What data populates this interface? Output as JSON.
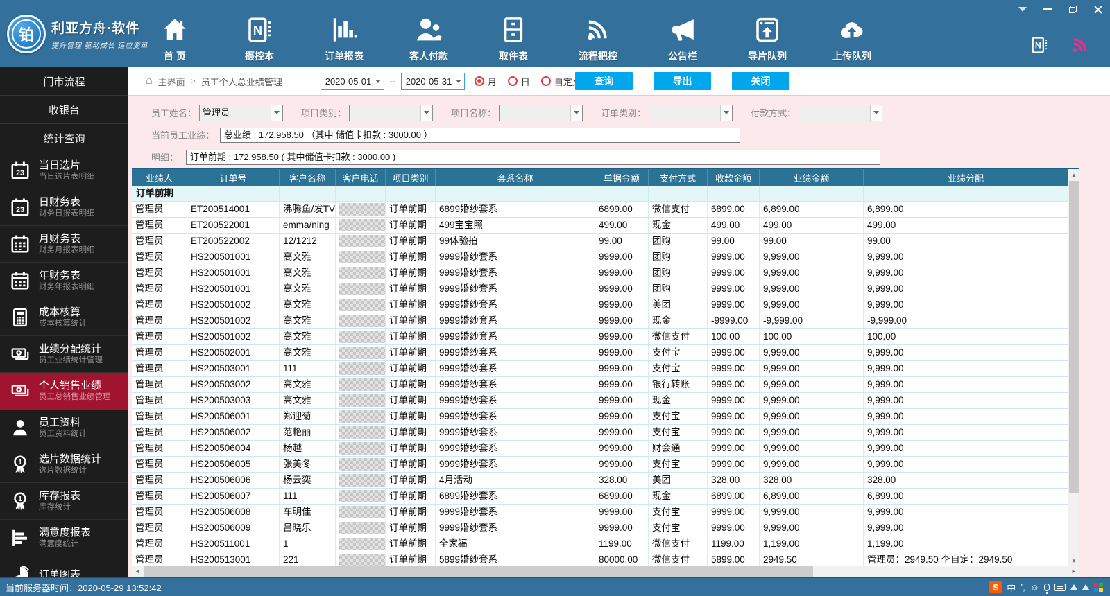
{
  "colors": {
    "topbar": "#33719C",
    "accent_button": "#01A7EC",
    "table_header": "#2A7396",
    "sidebar_active": "#A01430",
    "filter_panel": "#FBE9EC",
    "radio_red": "#E03C3C"
  },
  "titlebar": {
    "controls": [
      {
        "name": "menu-collapse"
      },
      {
        "name": "minimize"
      },
      {
        "name": "restore"
      },
      {
        "name": "close"
      }
    ]
  },
  "brand": {
    "logo_char": "铂",
    "name": "利亚方舟·软件",
    "tagline": "提升管理  驱动成长  适应变革"
  },
  "toolbar": {
    "items": [
      {
        "label": "首 页",
        "icon": "home-icon"
      },
      {
        "label": "摄控本",
        "icon": "notebook-icon"
      },
      {
        "label": "订单报表",
        "icon": "report-chart-icon"
      },
      {
        "label": "客人付款",
        "icon": "customers-icon"
      },
      {
        "label": "取件表",
        "icon": "pickup-cabinet-icon"
      },
      {
        "label": "流程把控",
        "icon": "workflow-signal-icon"
      },
      {
        "label": "公告栏",
        "icon": "megaphone-icon"
      },
      {
        "label": "导片队列",
        "icon": "export-queue-icon"
      },
      {
        "label": "上传队列",
        "icon": "cloud-upload-icon"
      }
    ],
    "tray": [
      {
        "icon": "onenote-icon"
      },
      {
        "icon": "wireless-pink-icon",
        "color": "#ED2E8D"
      }
    ]
  },
  "sidebar": {
    "entries": [
      {
        "type": "header",
        "label": "门市流程"
      },
      {
        "type": "header",
        "label": "收银台"
      },
      {
        "type": "header",
        "label": "统计查询"
      },
      {
        "type": "item",
        "icon": "calendar-day-icon",
        "title": "当日选片",
        "subtitle": "当日选片表明细"
      },
      {
        "type": "item",
        "icon": "calendar-day-icon",
        "title": "日财务表",
        "subtitle": "财务日报表明细"
      },
      {
        "type": "item",
        "icon": "calendar-month-icon",
        "title": "月财务表",
        "subtitle": "财务月报表明细"
      },
      {
        "type": "item",
        "icon": "calendar-year-icon",
        "title": "年财务表",
        "subtitle": "财务年报表明细"
      },
      {
        "type": "item",
        "icon": "calculator-icon",
        "title": "成本核算",
        "subtitle": "成本核算统计"
      },
      {
        "type": "item",
        "icon": "money-icon",
        "title": "业绩分配统计",
        "subtitle": "员工业绩统计管理"
      },
      {
        "type": "item",
        "icon": "money-icon",
        "title": "个人销售业绩",
        "subtitle": "员工总销售业绩管理",
        "active": true
      },
      {
        "type": "item",
        "icon": "person-icon",
        "title": "员工资料",
        "subtitle": "员工资料统计"
      },
      {
        "type": "item",
        "icon": "medal-icon",
        "title": "选片数据统计",
        "subtitle": "选片数据统计"
      },
      {
        "type": "item",
        "icon": "medal-icon",
        "title": "库存报表",
        "subtitle": "库存统计"
      },
      {
        "type": "item",
        "icon": "hbar-chart-icon",
        "title": "满意度报表",
        "subtitle": "满意度统计"
      },
      {
        "type": "item",
        "icon": "pie-chart-icon",
        "title": "订单图表",
        "subtitle": ""
      }
    ]
  },
  "breadcrumb": {
    "home_icon": "home-small-icon",
    "root": "主界面",
    "separator": ">",
    "current": "员工个人总业绩管理"
  },
  "date_filter": {
    "from": "2020-05-01",
    "separator": "--",
    "to": "2020-05-31",
    "options": [
      {
        "label": "月",
        "selected": true
      },
      {
        "label": "日",
        "selected": false
      },
      {
        "label": "自定义",
        "selected": false
      }
    ]
  },
  "action_buttons": [
    "查询",
    "导出",
    "关闭"
  ],
  "filters": [
    {
      "label": "员工姓名：",
      "value": "管理员"
    },
    {
      "label": "项目类别：",
      "value": ""
    },
    {
      "label": "项目名称：",
      "value": ""
    },
    {
      "label": "订单类别：",
      "value": ""
    },
    {
      "label": "付款方式：",
      "value": ""
    }
  ],
  "summary": {
    "performance_label": "当前员工业绩：",
    "performance_value": "总业绩 : 172,958.50   （其中  储值卡扣款 : 3000.00 ）",
    "detail_label": "明细：",
    "detail_value": "订单前期 : 172,958.50 ( 其中储值卡扣款 : 3000.00 )"
  },
  "table": {
    "columns": [
      "业绩人",
      "订单号",
      "客户名称",
      "客户电话",
      "项目类别",
      "套系名称",
      "单据金额",
      "支付方式",
      "收款金额",
      "业绩金额",
      "业绩分配"
    ],
    "group_header": "订单前期",
    "phone_censored": true,
    "rows": [
      [
        "管理员",
        "ET200514001",
        "沸腾鱼/发TV",
        "订单前期",
        "6899婚纱套系",
        "6899.00",
        "微信支付",
        "6899.00",
        "6,899.00",
        "6,899.00"
      ],
      [
        "管理员",
        "ET200522001",
        "emma/ning",
        "订单前期",
        "499宝宝照",
        "499.00",
        "现金",
        "499.00",
        "499.00",
        "499.00"
      ],
      [
        "管理员",
        "ET200522002",
        "12/1212",
        "订单前期",
        "99体验拍",
        "99.00",
        "团购",
        "99.00",
        "99.00",
        "99.00"
      ],
      [
        "管理员",
        "HS200501001",
        "高文雅",
        "订单前期",
        "9999婚纱套系",
        "9999.00",
        "团购",
        "9999.00",
        "9,999.00",
        "9,999.00"
      ],
      [
        "管理员",
        "HS200501001",
        "高文雅",
        "订单前期",
        "9999婚纱套系",
        "9999.00",
        "团购",
        "9999.00",
        "9,999.00",
        "9,999.00"
      ],
      [
        "管理员",
        "HS200501001",
        "高文雅",
        "订单前期",
        "9999婚纱套系",
        "9999.00",
        "团购",
        "9999.00",
        "9,999.00",
        "9,999.00"
      ],
      [
        "管理员",
        "HS200501002",
        "高文雅",
        "订单前期",
        "9999婚纱套系",
        "9999.00",
        "美团",
        "9999.00",
        "9,999.00",
        "9,999.00"
      ],
      [
        "管理员",
        "HS200501002",
        "高文雅",
        "订单前期",
        "9999婚纱套系",
        "9999.00",
        "现金",
        "-9999.00",
        "-9,999.00",
        "-9,999.00"
      ],
      [
        "管理员",
        "HS200501002",
        "高文雅",
        "订单前期",
        "9999婚纱套系",
        "9999.00",
        "微信支付",
        "100.00",
        "100.00",
        "100.00"
      ],
      [
        "管理员",
        "HS200502001",
        "高文雅",
        "订单前期",
        "9999婚纱套系",
        "9999.00",
        "支付宝",
        "9999.00",
        "9,999.00",
        "9,999.00"
      ],
      [
        "管理员",
        "HS200503001",
        "111",
        "订单前期",
        "9999婚纱套系",
        "9999.00",
        "支付宝",
        "9999.00",
        "9,999.00",
        "9,999.00"
      ],
      [
        "管理员",
        "HS200503002",
        "高文雅",
        "订单前期",
        "9999婚纱套系",
        "9999.00",
        "银行转账",
        "9999.00",
        "9,999.00",
        "9,999.00"
      ],
      [
        "管理员",
        "HS200503003",
        "高文雅",
        "订单前期",
        "9999婚纱套系",
        "9999.00",
        "现金",
        "9999.00",
        "9,999.00",
        "9,999.00"
      ],
      [
        "管理员",
        "HS200506001",
        "郑迎菊",
        "订单前期",
        "9999婚纱套系",
        "9999.00",
        "支付宝",
        "9999.00",
        "9,999.00",
        "9,999.00"
      ],
      [
        "管理员",
        "HS200506002",
        "范艳丽",
        "订单前期",
        "9999婚纱套系",
        "9999.00",
        "支付宝",
        "9999.00",
        "9,999.00",
        "9,999.00"
      ],
      [
        "管理员",
        "HS200506004",
        "杨越",
        "订单前期",
        "9999婚纱套系",
        "9999.00",
        "财会通",
        "9999.00",
        "9,999.00",
        "9,999.00"
      ],
      [
        "管理员",
        "HS200506005",
        "张美冬",
        "订单前期",
        "9999婚纱套系",
        "9999.00",
        "支付宝",
        "9999.00",
        "9,999.00",
        "9,999.00"
      ],
      [
        "管理员",
        "HS200506006",
        "杨云奕",
        "订单前期",
        "4月活动",
        "328.00",
        "美团",
        "328.00",
        "328.00",
        "328.00"
      ],
      [
        "管理员",
        "HS200506007",
        "111",
        "订单前期",
        "6899婚纱套系",
        "6899.00",
        "现金",
        "6899.00",
        "6,899.00",
        "6,899.00"
      ],
      [
        "管理员",
        "HS200506008",
        "车明佳",
        "订单前期",
        "9999婚纱套系",
        "9999.00",
        "支付宝",
        "9999.00",
        "9,999.00",
        "9,999.00"
      ],
      [
        "管理员",
        "HS200506009",
        "吕晓乐",
        "订单前期",
        "9999婚纱套系",
        "9999.00",
        "支付宝",
        "9999.00",
        "9,999.00",
        "9,999.00"
      ],
      [
        "管理员",
        "HS200511001",
        "1",
        "订单前期",
        "全家福",
        "1199.00",
        "微信支付",
        "1199.00",
        "1,199.00",
        "1,199.00"
      ],
      [
        "管理员",
        "HS200513001",
        "221",
        "订单前期",
        "5899婚纱套系",
        "80000.00",
        "微信支付",
        "5899.00",
        "2949.50",
        "管理员：2949.50  李自定：2949.50"
      ]
    ]
  },
  "status_bar": {
    "server_time": "当前服务器时间：2020-05-29 13:52:42",
    "ime_icons": [
      "sogou-icon",
      "chinese-mode-icon",
      "punctuation-icon",
      "emoji-icon",
      "mic-icon",
      "keyboard-icon",
      "upload-icon",
      "upload-icon",
      "apps-grid-icon"
    ]
  }
}
